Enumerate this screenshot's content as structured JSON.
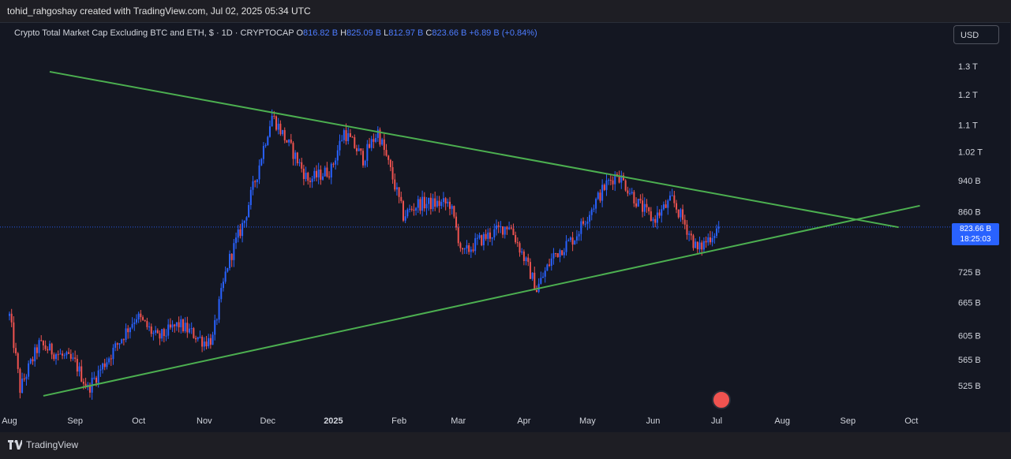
{
  "caption": "tohid_rahgoshay created with TradingView.com, Jul 02, 2025 05:34 UTC",
  "legend": {
    "title": "Crypto Total Market Cap Excluding BTC and ETH, $ · 1D · CRYPTOCAP",
    "o_label": "O",
    "o_value": "816.82 B",
    "h_label": "H",
    "h_value": "825.09 B",
    "l_label": "L",
    "l_value": "812.97 B",
    "c_label": "C",
    "c_value": "823.66 B",
    "change": "+6.89 B (+0.84%)"
  },
  "currency_button": "USD",
  "price_tag": {
    "price": "823.66 B",
    "countdown": "18:25:03"
  },
  "brand": "TradingView",
  "colors": {
    "up": "#2962ff",
    "down": "#ef5350",
    "trendline": "#4caf50",
    "background": "#141722"
  },
  "chart_data": {
    "type": "candlestick",
    "title": "Crypto Total Market Cap Excluding BTC and ETH",
    "y_scale": "log",
    "y_ticks": [
      "1.3 T",
      "1.2 T",
      "1.1 T",
      "1.02 T",
      "940 B",
      "860 B",
      "795 B",
      "725 B",
      "665 B",
      "605 B",
      "565 B",
      "525 B"
    ],
    "x_ticks": [
      "Aug",
      "Sep",
      "Oct",
      "Nov",
      "Dec",
      "2025",
      "Feb",
      "Mar",
      "Apr",
      "May",
      "Jun",
      "Jul",
      "Aug",
      "Sep",
      "Oct"
    ],
    "last_price": 823.66,
    "series_approx_close_billion": {
      "dates": [
        "2024-08-01",
        "2024-08-06",
        "2024-08-15",
        "2024-09-01",
        "2024-09-07",
        "2024-09-20",
        "2024-09-30",
        "2024-10-10",
        "2024-10-20",
        "2024-11-01",
        "2024-11-05",
        "2024-11-12",
        "2024-11-20",
        "2024-11-26",
        "2024-12-03",
        "2024-12-10",
        "2024-12-20",
        "2024-12-31",
        "2025-01-06",
        "2025-01-15",
        "2025-01-22",
        "2025-02-03",
        "2025-02-10",
        "2025-02-25",
        "2025-03-03",
        "2025-03-10",
        "2025-03-25",
        "2025-04-07",
        "2025-04-15",
        "2025-04-25",
        "2025-05-10",
        "2025-05-15",
        "2025-05-25",
        "2025-06-01",
        "2025-06-10",
        "2025-06-18",
        "2025-06-22",
        "2025-07-02"
      ],
      "values": [
        640,
        520,
        590,
        560,
        520,
        585,
        640,
        600,
        625,
        595,
        600,
        740,
        840,
        960,
        1130,
        1050,
        940,
        970,
        1080,
        1000,
        1080,
        850,
        880,
        880,
        760,
        790,
        830,
        690,
        760,
        800,
        930,
        960,
        880,
        840,
        890,
        810,
        770,
        823.66
      ]
    },
    "trendlines": [
      {
        "name": "upper",
        "from": {
          "date": "2024-08-20",
          "value": 1280
        },
        "to": {
          "date": "2025-09-25",
          "value": 823
        }
      },
      {
        "name": "lower",
        "from": {
          "date": "2024-08-17",
          "value": 510
        },
        "to": {
          "date": "2025-10-05",
          "value": 875
        }
      }
    ]
  }
}
